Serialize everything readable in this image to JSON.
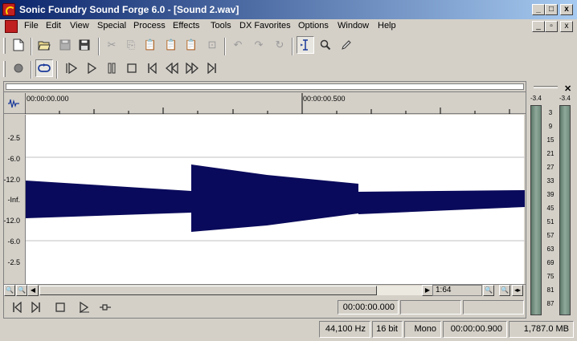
{
  "window": {
    "title": "Sonic Foundry Sound Forge 6.0 - [Sound 2.wav]",
    "buttons": [
      "_",
      "□",
      "x"
    ]
  },
  "menubar": {
    "items": [
      "File",
      "Edit",
      "View",
      "Special",
      "Process",
      "Effects",
      "Tools",
      "DX Favorites",
      "Options",
      "Window",
      "Help"
    ],
    "mdi_buttons": [
      "_",
      "▫",
      "x"
    ]
  },
  "toolbar_standard": {
    "tools": [
      {
        "name": "new-icon",
        "glyph": "🗋",
        "enabled": true
      },
      {
        "name": "open-icon",
        "glyph": "📂",
        "enabled": true
      },
      {
        "name": "save-icon",
        "glyph": "💾",
        "enabled": false
      },
      {
        "name": "save-as-icon",
        "glyph": "💾",
        "enabled": true
      },
      {
        "name": "cut-icon",
        "glyph": "✂",
        "enabled": false
      },
      {
        "name": "copy-icon",
        "glyph": "⎘",
        "enabled": false
      },
      {
        "name": "paste-icon",
        "glyph": "📋",
        "enabled": false
      },
      {
        "name": "mix-icon",
        "glyph": "📋",
        "enabled": false
      },
      {
        "name": "crossfade-icon",
        "glyph": "📋",
        "enabled": false
      },
      {
        "name": "trim-icon",
        "glyph": "⊡",
        "enabled": false
      },
      {
        "name": "undo-icon",
        "glyph": "↶",
        "enabled": false
      },
      {
        "name": "redo-icon",
        "glyph": "↷",
        "enabled": false
      },
      {
        "name": "repeat-icon",
        "glyph": "↻",
        "enabled": false
      },
      {
        "name": "edit-tool-icon",
        "glyph": "I",
        "enabled": true,
        "active": true
      },
      {
        "name": "magnify-tool-icon",
        "glyph": "🔍",
        "enabled": true
      },
      {
        "name": "pencil-tool-icon",
        "glyph": "✎",
        "enabled": true
      }
    ]
  },
  "toolbar_transport": {
    "tools": [
      {
        "name": "record-icon",
        "glyph": "●",
        "active": false
      },
      {
        "name": "loop-playback-icon",
        "glyph": "⟲",
        "active": true
      },
      {
        "name": "play-all-icon",
        "glyph": "▷",
        "active": false
      },
      {
        "name": "play-icon",
        "glyph": "▷",
        "active": false
      },
      {
        "name": "pause-icon",
        "glyph": "❚❚",
        "active": false
      },
      {
        "name": "stop-icon",
        "glyph": "■",
        "active": false
      },
      {
        "name": "go-to-start-icon",
        "glyph": "|◁",
        "active": false
      },
      {
        "name": "rewind-icon",
        "glyph": "◁◁",
        "active": false
      },
      {
        "name": "forward-icon",
        "glyph": "▷▷",
        "active": false
      },
      {
        "name": "go-to-end-icon",
        "glyph": "▷|",
        "active": false
      }
    ]
  },
  "data_window": {
    "ruler_labels": [
      "00:00:00.000",
      "00:00:00.500"
    ],
    "scale_labels": [
      "-2.5",
      "-6.0",
      "-12.0",
      "-Inf.",
      "-12.0",
      "-6.0",
      "-2.5"
    ],
    "zoom": "1:64",
    "position": "00:00:00.000",
    "selection_start": "",
    "selection_end": "",
    "waveform_color": "#0a0a5c"
  },
  "meters": {
    "peak_left": "-3.4",
    "peak_right": "-3.4",
    "labels": [
      "3",
      "9",
      "15",
      "21",
      "27",
      "33",
      "39",
      "45",
      "51",
      "57",
      "63",
      "69",
      "75",
      "81",
      "87"
    ]
  },
  "statusbar": {
    "sample_rate": "44,100 Hz",
    "bit_depth": "16 bit",
    "channels": "Mono",
    "length": "00:00:00.900",
    "free_space": "1,787.0 MB"
  }
}
